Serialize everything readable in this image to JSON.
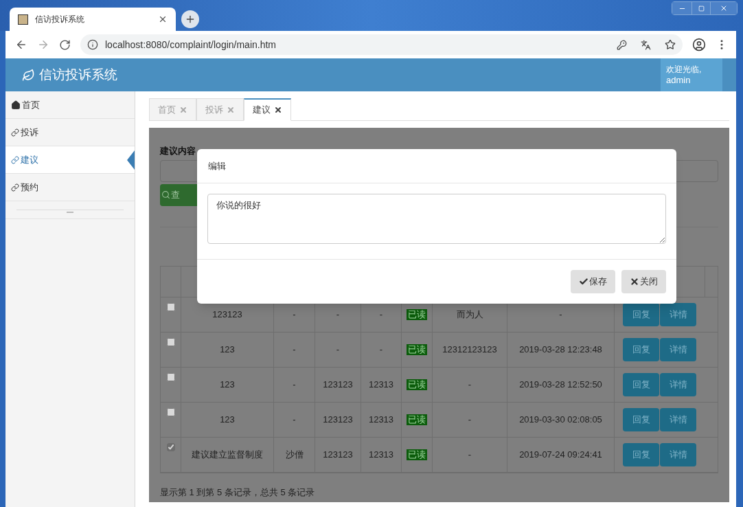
{
  "browser": {
    "tab_title": "信访投诉系统",
    "url": "localhost:8080/complaint/login/main.htm"
  },
  "header": {
    "title": "信访投诉系统",
    "welcome": "欢迎光临,",
    "user": "admin"
  },
  "sidebar": {
    "items": [
      {
        "kind": "home",
        "label": "首页",
        "selected": false
      },
      {
        "kind": "link",
        "label": "投诉",
        "selected": false
      },
      {
        "kind": "link",
        "label": "建议",
        "selected": true
      },
      {
        "kind": "link",
        "label": "预约",
        "selected": false
      }
    ]
  },
  "tabs": [
    {
      "label": "首页",
      "selected": false
    },
    {
      "label": "投诉",
      "selected": false
    },
    {
      "label": "建议",
      "selected": true
    }
  ],
  "search": {
    "label": "建议内容",
    "button": "查"
  },
  "table": {
    "rows": [
      {
        "checked": false,
        "cells": [
          "123123",
          "-",
          "-",
          "-"
        ],
        "status": "已读",
        "content": "而为人",
        "time": "-",
        "actions": [
          "回复",
          "详情"
        ]
      },
      {
        "checked": false,
        "cells": [
          "123",
          "-",
          "-",
          "-"
        ],
        "status": "已读",
        "content": "12312123123",
        "time": "2019-03-28 12:23:48",
        "actions": [
          "回复",
          "详情"
        ]
      },
      {
        "checked": false,
        "cells": [
          "123",
          "-",
          "123123",
          "12313"
        ],
        "status": "已读",
        "content": "-",
        "time": "2019-03-28 12:52:50",
        "actions": [
          "回复",
          "详情"
        ]
      },
      {
        "checked": false,
        "cells": [
          "123",
          "-",
          "123123",
          "12313"
        ],
        "status": "已读",
        "content": "-",
        "time": "2019-03-30 02:08:05",
        "actions": [
          "回复",
          "详情"
        ]
      },
      {
        "checked": true,
        "cells": [
          "建议建立监督制度",
          "沙僧",
          "123123",
          "12313"
        ],
        "status": "已读",
        "content": "-",
        "time": "2019-07-24 09:24:41",
        "actions": [
          "回复",
          "详情"
        ]
      }
    ]
  },
  "footer": "显示第 1 到第 5 条记录，总共 5 条记录",
  "modal": {
    "title": "编辑",
    "value": "你说的很好",
    "buttons": [
      {
        "kind": "save",
        "label": "保存"
      },
      {
        "kind": "close",
        "label": "关闭"
      }
    ]
  }
}
